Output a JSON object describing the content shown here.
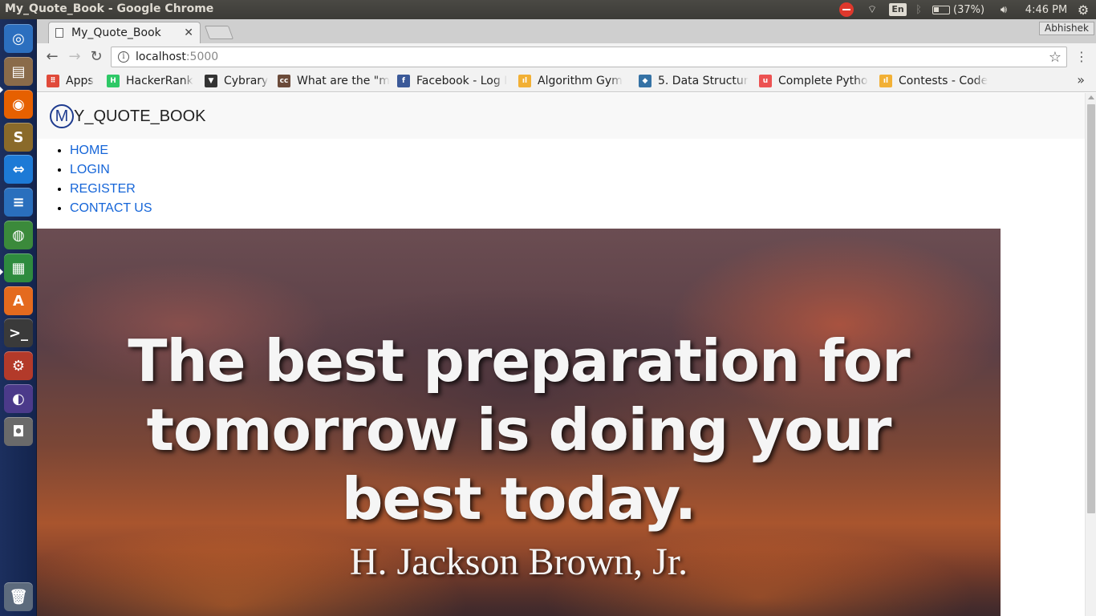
{
  "os": {
    "window_title": "My_Quote_Book - Google Chrome",
    "tray": {
      "language": "En",
      "battery": "(37%)",
      "clock": "4:46 PM"
    },
    "launcher": [
      {
        "name": "dash-icon",
        "glyph": "◎",
        "color": "#2c6fbf"
      },
      {
        "name": "files-icon",
        "glyph": "▤",
        "color": "#8a6b4a"
      },
      {
        "name": "firefox-icon",
        "glyph": "◉",
        "color": "#e66000"
      },
      {
        "name": "sublime-text-icon",
        "glyph": "S",
        "color": "#8a6a2a"
      },
      {
        "name": "teamviewer-icon",
        "glyph": "⇔",
        "color": "#1d7ad6"
      },
      {
        "name": "writer-icon",
        "glyph": "≡",
        "color": "#2a6fbd"
      },
      {
        "name": "chrome-icon",
        "glyph": "◍",
        "color": "#3b8a3b"
      },
      {
        "name": "calc-icon",
        "glyph": "▦",
        "color": "#2e8b3e"
      },
      {
        "name": "software-center-icon",
        "glyph": "A",
        "color": "#e46a1e"
      },
      {
        "name": "terminal-icon",
        "glyph": ">_",
        "color": "#3a3a3a"
      },
      {
        "name": "system-settings-icon",
        "glyph": "⚙",
        "color": "#b33a2a"
      },
      {
        "name": "eclipse-icon",
        "glyph": "◐",
        "color": "#4b3a8a"
      },
      {
        "name": "camera-icon",
        "glyph": "◘",
        "color": "#6a6a6a"
      }
    ],
    "trash_glyph": "🗑"
  },
  "browser": {
    "tab_title": "My_Quote_Book",
    "profile": "Abhishek",
    "url_host": "localhost",
    "url_port": ":5000",
    "bookmarks": [
      {
        "name": "bookmark-apps",
        "label": "Apps",
        "icon_color": "#e04a3a",
        "glyph": "⠿"
      },
      {
        "name": "bookmark-hackerrank",
        "label": "HackerRank",
        "icon_color": "#2ec866",
        "glyph": "H"
      },
      {
        "name": "bookmark-cybrary",
        "label": "Cybrary",
        "icon_color": "#333333",
        "glyph": "▼"
      },
      {
        "name": "bookmark-what-are-the",
        "label": "What are the \"m",
        "icon_color": "#6b4b3a",
        "glyph": "cc"
      },
      {
        "name": "bookmark-facebook",
        "label": "Facebook - Log I",
        "icon_color": "#3b5998",
        "glyph": "f"
      },
      {
        "name": "bookmark-algorithm-gym",
        "label": "Algorithm Gym",
        "icon_color": "#f2b035",
        "glyph": "ıl"
      },
      {
        "name": "bookmark-data-structures",
        "label": "5. Data Structur",
        "icon_color": "#3572a5",
        "glyph": "◆"
      },
      {
        "name": "bookmark-complete-python",
        "label": "Complete Pytho",
        "icon_color": "#ec5252",
        "glyph": "u"
      },
      {
        "name": "bookmark-contests",
        "label": "Contests - Code",
        "icon_color": "#f2b035",
        "glyph": "ıl"
      }
    ]
  },
  "site": {
    "brand_letter": "M",
    "brand_rest": "Y_QUOTE_BOOK",
    "nav": [
      "HOME",
      "LOGIN",
      "REGISTER",
      "CONTACT US"
    ],
    "quote": "The best preparation for tomorrow is doing your best today.",
    "author": "H. Jackson Brown, Jr."
  }
}
